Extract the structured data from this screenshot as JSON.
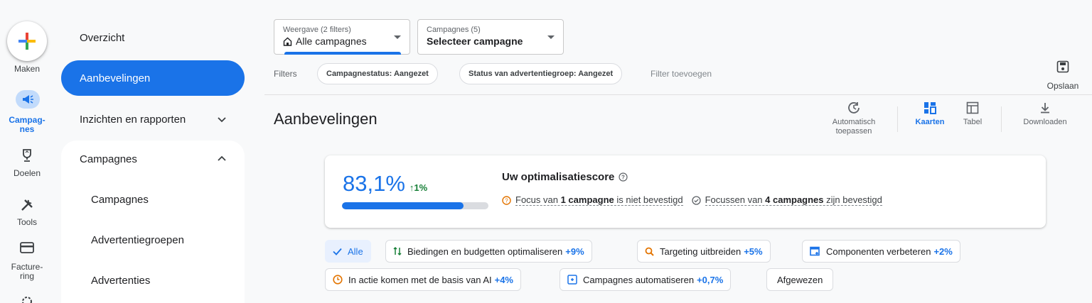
{
  "rail": {
    "create_label": "Maken",
    "items": [
      {
        "label": "Campag-\nnes",
        "line1": "Campag-",
        "line2": "nes"
      },
      {
        "label": "Doelen"
      },
      {
        "label": "Tools"
      },
      {
        "line1": "Facture-",
        "line2": "ring"
      }
    ]
  },
  "sidebar": {
    "overview": "Overzicht",
    "recommendations": "Aanbevelingen",
    "insights": "Inzichten en rapporten",
    "campaigns_section": "Campagnes",
    "sub_items": [
      "Campagnes",
      "Advertentiegroepen",
      "Advertenties"
    ]
  },
  "view_dropdown": {
    "label": "Weergave (2 filters)",
    "value": "Alle campagnes"
  },
  "campaign_dropdown": {
    "label": "Campagnes (5)",
    "value": "Selecteer campagne"
  },
  "filters": {
    "label": "Filters",
    "chips": [
      "Campagnestatus: Aangezet",
      "Status van advertentiegroep: Aangezet"
    ],
    "add": "Filter toevoegen"
  },
  "save_label": "Opslaan",
  "page_title": "Aanbevelingen",
  "tools": {
    "auto_apply_1": "Automatisch",
    "auto_apply_2": "toepassen",
    "cards": "Kaarten",
    "table": "Tabel",
    "download": "Downloaden"
  },
  "score": {
    "value": "83,1%",
    "fraction": 0.831,
    "delta": "↑1%",
    "title": "Uw optimalisatiescore",
    "unconfirmed_pre": "Focus van ",
    "unconfirmed_bold": "1 campagne",
    "unconfirmed_post": " is niet bevestigd",
    "confirmed_pre": "Focussen van ",
    "confirmed_bold": "4 campagnes",
    "confirmed_post": " zijn bevestigd"
  },
  "categories": {
    "all": "Alle",
    "bids": "Biedingen en budgetten optimaliseren",
    "bids_pct": "+9%",
    "targeting": "Targeting uitbreiden",
    "targeting_pct": "+5%",
    "assets": "Componenten verbeteren",
    "assets_pct": "+2%",
    "ai": "In actie komen met de basis van AI",
    "ai_pct": "+4%",
    "automate": "Campagnes automatiseren",
    "automate_pct": "+0,7%",
    "dismissed": "Afgewezen"
  },
  "colors": {
    "accent": "#1a73e8",
    "positive": "#188038",
    "warning": "#e37400"
  }
}
